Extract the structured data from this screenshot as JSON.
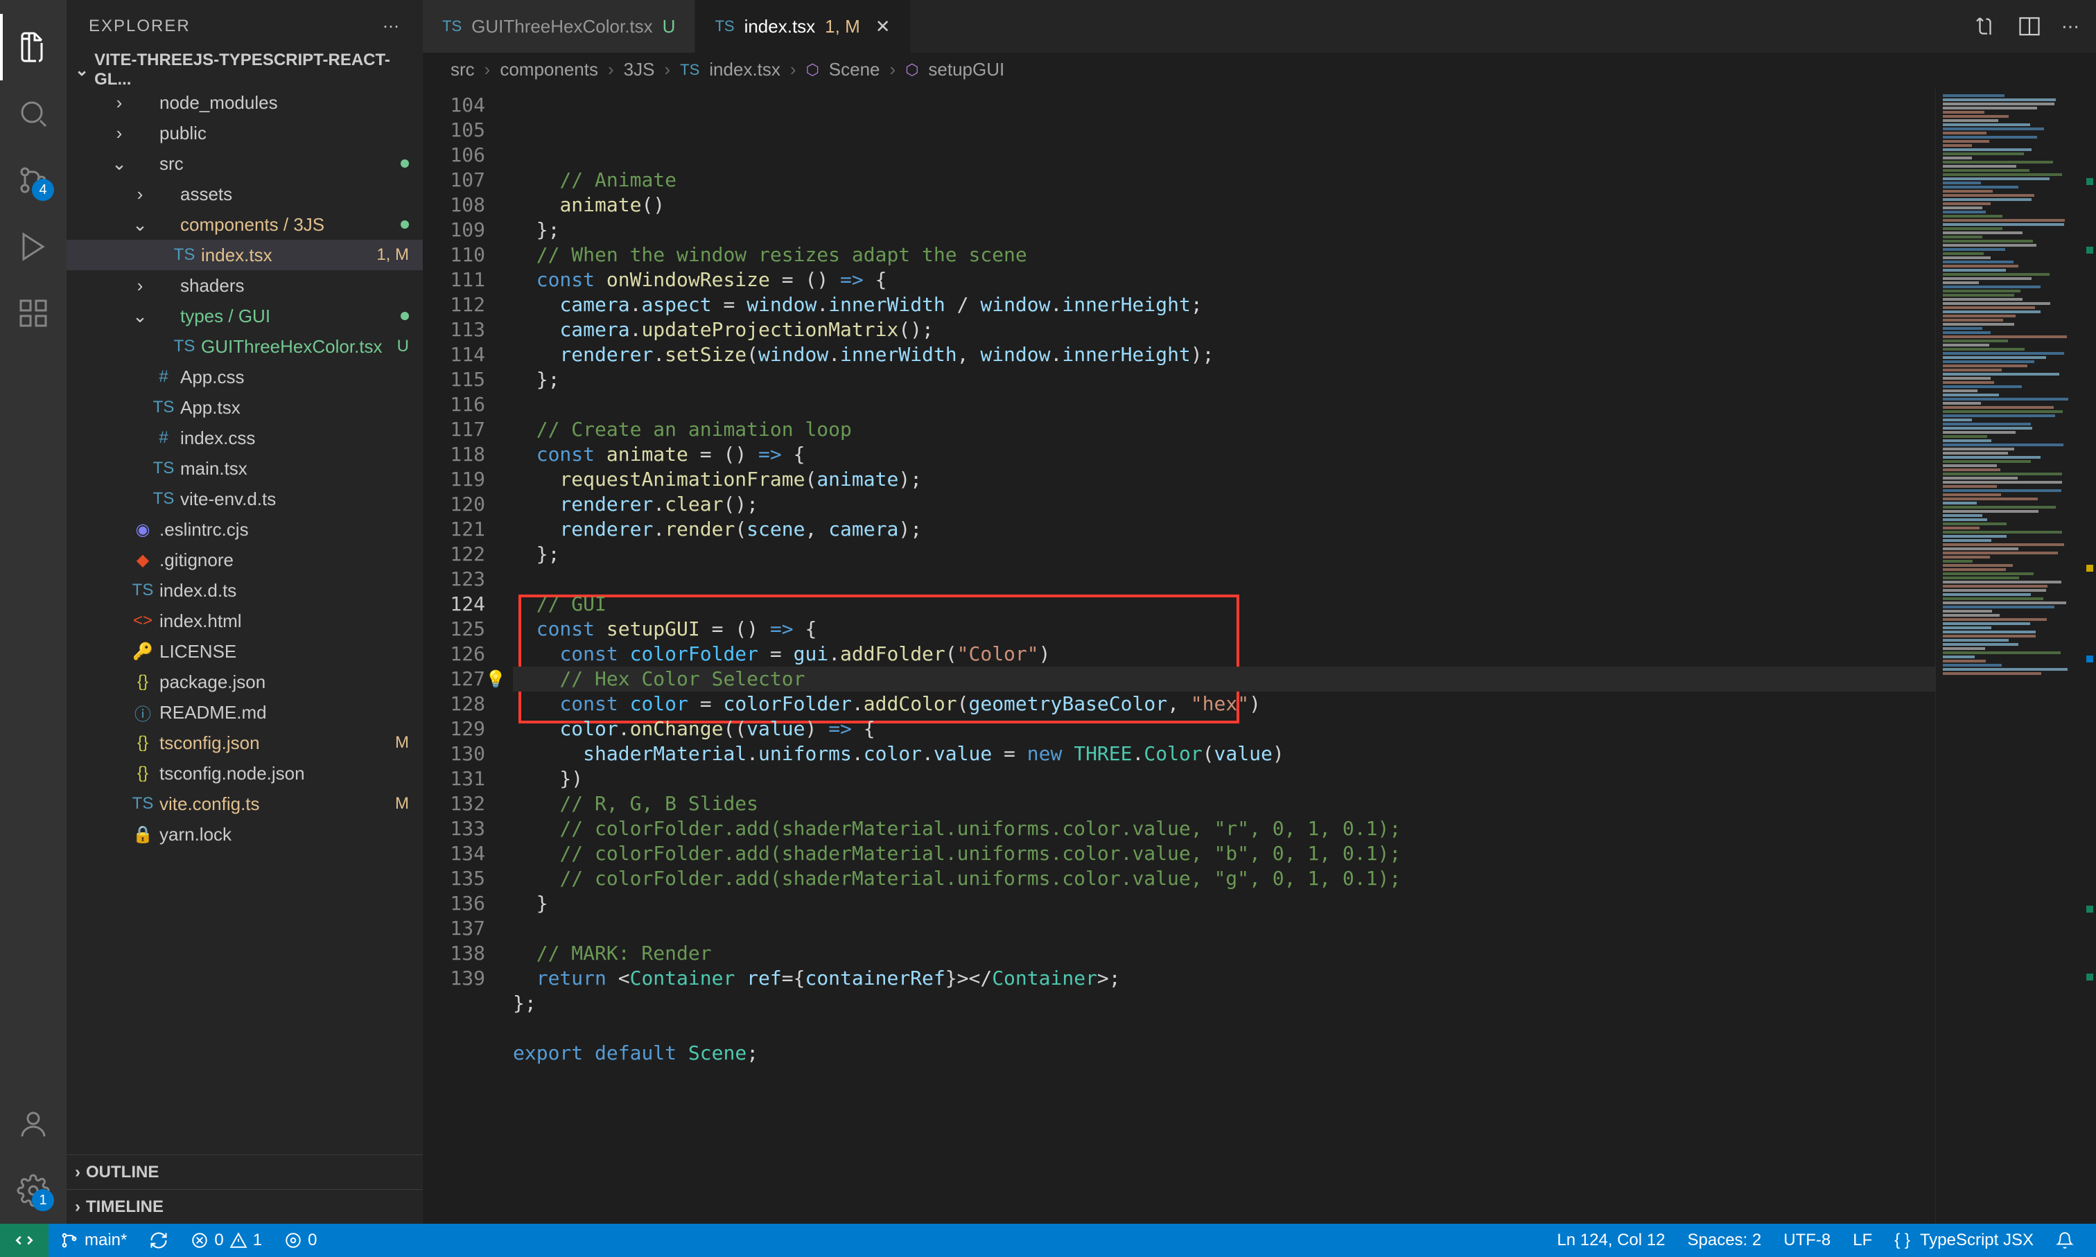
{
  "sidebar": {
    "title": "EXPLORER",
    "project": "VITE-THREEJS-TYPESCRIPT-REACT-GL...",
    "tree": [
      {
        "label": "node_modules",
        "kind": "folder",
        "indent": 1,
        "chev": "right"
      },
      {
        "label": "public",
        "kind": "folder",
        "indent": 1,
        "chev": "right"
      },
      {
        "label": "src",
        "kind": "folder",
        "indent": 1,
        "chev": "down",
        "dot": true
      },
      {
        "label": "assets",
        "kind": "folder",
        "indent": 2,
        "chev": "right"
      },
      {
        "label": "components / 3JS",
        "kind": "folder",
        "indent": 2,
        "chev": "down",
        "mod": true,
        "dot": true
      },
      {
        "label": "index.tsx",
        "kind": "ts",
        "indent": 3,
        "active": true,
        "badge": "1, M",
        "mod": true
      },
      {
        "label": "shaders",
        "kind": "folder",
        "indent": 2,
        "chev": "right"
      },
      {
        "label": "types / GUI",
        "kind": "folder",
        "indent": 2,
        "chev": "down",
        "untracked": true,
        "dot": true
      },
      {
        "label": "GUIThreeHexColor.tsx",
        "kind": "ts",
        "indent": 3,
        "badge": "U",
        "untracked": true
      },
      {
        "label": "App.css",
        "kind": "css",
        "indent": 2
      },
      {
        "label": "App.tsx",
        "kind": "ts",
        "indent": 2
      },
      {
        "label": "index.css",
        "kind": "css",
        "indent": 2
      },
      {
        "label": "main.tsx",
        "kind": "ts",
        "indent": 2
      },
      {
        "label": "vite-env.d.ts",
        "kind": "ts",
        "indent": 2
      },
      {
        "label": ".eslintrc.cjs",
        "kind": "eslint",
        "indent": 1
      },
      {
        "label": ".gitignore",
        "kind": "git",
        "indent": 1
      },
      {
        "label": "index.d.ts",
        "kind": "ts",
        "indent": 1
      },
      {
        "label": "index.html",
        "kind": "html",
        "indent": 1
      },
      {
        "label": "LICENSE",
        "kind": "license",
        "indent": 1
      },
      {
        "label": "package.json",
        "kind": "json",
        "indent": 1
      },
      {
        "label": "README.md",
        "kind": "md",
        "indent": 1
      },
      {
        "label": "tsconfig.json",
        "kind": "json",
        "indent": 1,
        "badge": "M",
        "mod": true
      },
      {
        "label": "tsconfig.node.json",
        "kind": "json",
        "indent": 1
      },
      {
        "label": "vite.config.ts",
        "kind": "ts",
        "indent": 1,
        "badge": "M",
        "mod": true
      },
      {
        "label": "yarn.lock",
        "kind": "lock",
        "indent": 1
      }
    ],
    "outline": "OUTLINE",
    "timeline": "TIMELINE"
  },
  "activity_badge": "4",
  "settings_badge": "1",
  "tabs": [
    {
      "label": "GUIThreeHexColor.tsx",
      "badge": "U",
      "untracked": true,
      "active": false
    },
    {
      "label": "index.tsx",
      "badge": "1, M",
      "mod": true,
      "active": true,
      "close": true
    }
  ],
  "breadcrumbs": [
    "src",
    "components",
    "3JS",
    "index.tsx",
    "Scene",
    "setupGUI"
  ],
  "code": {
    "start": 104,
    "current": 124,
    "lines": [
      {
        "t": "    <span class='c-com'>// Animate</span>"
      },
      {
        "t": "    <span class='c-fn'>animate</span>()"
      },
      {
        "t": "  };"
      },
      {
        "t": "  <span class='c-com'>// When the window resizes adapt the scene</span>"
      },
      {
        "t": "  <span class='c-kw'>const</span> <span class='c-fn'>onWindowResize</span> = () <span class='c-kw'>=&gt;</span> {"
      },
      {
        "t": "    <span class='c-var'>camera</span>.<span class='c-var'>aspect</span> = <span class='c-var'>window</span>.<span class='c-var'>innerWidth</span> / <span class='c-var'>window</span>.<span class='c-var'>innerHeight</span>;"
      },
      {
        "t": "    <span class='c-var'>camera</span>.<span class='c-fn'>updateProjectionMatrix</span>();"
      },
      {
        "t": "    <span class='c-var'>renderer</span>.<span class='c-fn'>setSize</span>(<span class='c-var'>window</span>.<span class='c-var'>innerWidth</span>, <span class='c-var'>window</span>.<span class='c-var'>innerHeight</span>);"
      },
      {
        "t": "  };"
      },
      {
        "t": ""
      },
      {
        "t": "  <span class='c-com'>// Create an animation loop</span>"
      },
      {
        "t": "  <span class='c-kw'>const</span> <span class='c-fn'>animate</span> = () <span class='c-kw'>=&gt;</span> {"
      },
      {
        "t": "    <span class='c-fn'>requestAnimationFrame</span>(<span class='c-var'>animate</span>);"
      },
      {
        "t": "    <span class='c-var'>renderer</span>.<span class='c-fn'>clear</span>();"
      },
      {
        "t": "    <span class='c-var'>renderer</span>.<span class='c-fn'>render</span>(<span class='c-var'>scene</span>, <span class='c-var'>camera</span>);"
      },
      {
        "t": "  };"
      },
      {
        "t": ""
      },
      {
        "t": "  <span class='c-com'>// GUI</span>"
      },
      {
        "t": "  <span class='c-kw'>const</span> <span class='c-fn'>setupGUI</span> = () <span class='c-kw'>=&gt;</span> {"
      },
      {
        "t": "    <span class='c-kw'>const</span> <span class='c-const'>colorFolder</span> = <span class='c-var'>gui</span>.<span class='c-fn'>addFolder</span>(<span class='c-str'>\"Color\"</span>)"
      },
      {
        "t": "    <span class='c-com'>// Hex Color Selector</span>",
        "current": true,
        "bulb": true
      },
      {
        "t": "    <span class='c-kw'>const</span> <span class='c-const'>color</span> = <span class='c-var'>colorFolder</span>.<span class='c-fn'>addColor</span>(<span class='c-var'>geometryBaseColor</span>, <span class='c-str'>\"hex\"</span>)"
      },
      {
        "t": "    <span class='c-var'>color</span>.<span class='c-fn'>onChange</span>((<span class='c-var'>value</span>) <span class='c-kw'>=&gt;</span> {"
      },
      {
        "t": "      <span class='c-var'>shaderMaterial</span>.<span class='c-var'>uniforms</span>.<span class='c-var'>color</span>.<span class='c-var'>value</span> = <span class='c-kw'>new</span> <span class='c-cls'>THREE</span>.<span class='c-cls'>Color</span>(<span class='c-var'>value</span>)"
      },
      {
        "t": "    })"
      },
      {
        "t": "    <span class='c-com'>// R, G, B Slides</span>"
      },
      {
        "t": "    <span class='c-com'>// colorFolder.add(shaderMaterial.uniforms.color.value, \"r\", 0, 1, 0.1);</span>"
      },
      {
        "t": "    <span class='c-com'>// colorFolder.add(shaderMaterial.uniforms.color.value, \"b\", 0, 1, 0.1);</span>"
      },
      {
        "t": "    <span class='c-com'>// colorFolder.add(shaderMaterial.uniforms.color.value, \"g\", 0, 1, 0.1);</span>"
      },
      {
        "t": "  }"
      },
      {
        "t": ""
      },
      {
        "t": "  <span class='c-com'>// MARK: Render</span>"
      },
      {
        "t": "  <span class='c-kw'>return</span> &lt;<span class='c-jsx'>Container</span> <span class='c-var'>ref</span>={<span class='c-var'>containerRef</span>}&gt;&lt;/<span class='c-jsx'>Container</span>&gt;;"
      },
      {
        "t": "};"
      },
      {
        "t": ""
      },
      {
        "t": "<span class='c-kw'>export</span> <span class='c-kw'>default</span> <span class='c-cls'>Scene</span>;"
      }
    ]
  },
  "status": {
    "branch": "main*",
    "errors": "0",
    "warnings": "1",
    "ports": "0",
    "cursor": "Ln 124, Col 12",
    "spaces": "Spaces: 2",
    "encoding": "UTF-8",
    "eol": "LF",
    "language": "TypeScript JSX"
  }
}
